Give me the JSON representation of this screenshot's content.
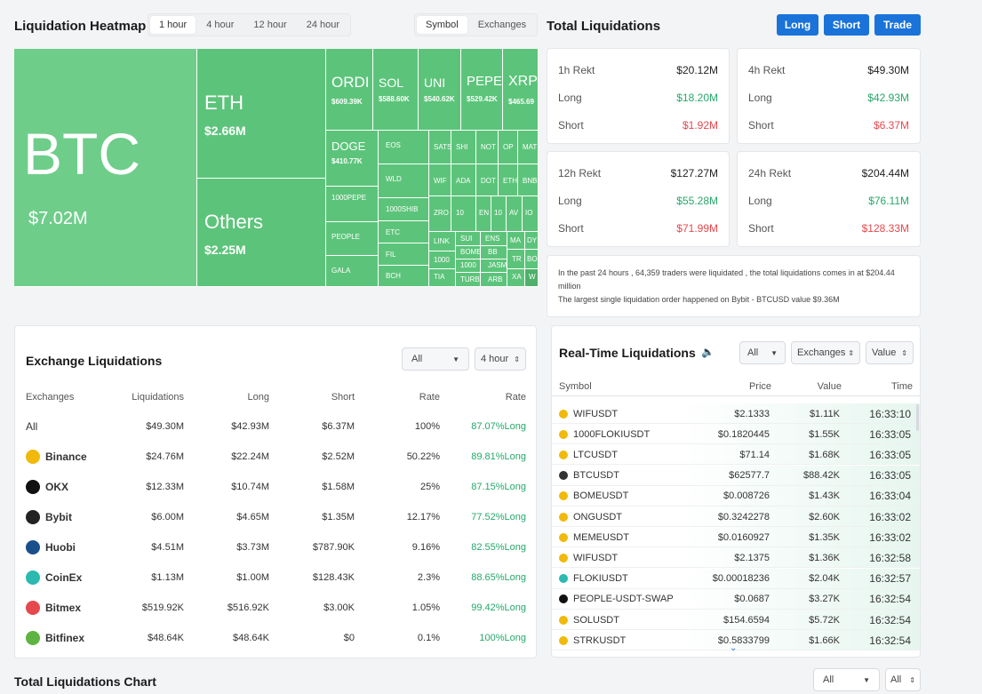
{
  "heatmap": {
    "title": "Liquidation Heatmap",
    "time_tabs": [
      "1 hour",
      "4 hour",
      "12 hour",
      "24 hour"
    ],
    "view_tabs": [
      "Symbol",
      "Exchanges"
    ],
    "tiles": [
      {
        "name": "BTC",
        "value": "$7.02M"
      },
      {
        "name": "ETH",
        "value": "$2.66M"
      },
      {
        "name": "Others",
        "value": "$2.25M"
      },
      {
        "name": "ORDI",
        "value": "$609.39K"
      },
      {
        "name": "SOL",
        "value": "$588.60K"
      },
      {
        "name": "UNI",
        "value": "$540.62K"
      },
      {
        "name": "PEPE",
        "value": "$529.42K"
      },
      {
        "name": "XRP",
        "value": "$465.69"
      },
      {
        "name": "DOGE",
        "value": "$410.77K"
      },
      {
        "name": "1000PEPE",
        "value": ""
      },
      {
        "name": "PEOPLE",
        "value": ""
      },
      {
        "name": "GALA",
        "value": ""
      },
      {
        "name": "EOS",
        "value": ""
      },
      {
        "name": "WLD",
        "value": ""
      },
      {
        "name": "1000SHIB",
        "value": ""
      },
      {
        "name": "ETC",
        "value": ""
      },
      {
        "name": "FIL",
        "value": ""
      },
      {
        "name": "BCH",
        "value": ""
      },
      {
        "name": "SATS",
        "value": ""
      },
      {
        "name": "SHI",
        "value": ""
      },
      {
        "name": "NOT",
        "value": ""
      },
      {
        "name": "OP",
        "value": ""
      },
      {
        "name": "MAT",
        "value": ""
      },
      {
        "name": "WIF",
        "value": ""
      },
      {
        "name": "ADA",
        "value": ""
      },
      {
        "name": "DOT",
        "value": ""
      },
      {
        "name": "ETH",
        "value": ""
      },
      {
        "name": "BNB",
        "value": ""
      },
      {
        "name": "ZRO",
        "value": ""
      },
      {
        "name": "10",
        "value": ""
      },
      {
        "name": "EN",
        "value": ""
      },
      {
        "name": "10",
        "value": ""
      },
      {
        "name": "AV",
        "value": ""
      },
      {
        "name": "IO",
        "value": ""
      },
      {
        "name": "LINK",
        "value": ""
      },
      {
        "name": "SUI",
        "value": ""
      },
      {
        "name": "ENS",
        "value": ""
      },
      {
        "name": "MA",
        "value": ""
      },
      {
        "name": "DY",
        "value": ""
      },
      {
        "name": "1000",
        "value": ""
      },
      {
        "name": "BOME",
        "value": ""
      },
      {
        "name": "BB",
        "value": ""
      },
      {
        "name": "TR",
        "value": ""
      },
      {
        "name": "BO",
        "value": ""
      },
      {
        "name": "TIA",
        "value": ""
      },
      {
        "name": "1000",
        "value": ""
      },
      {
        "name": "JASM",
        "value": ""
      },
      {
        "name": "XA",
        "value": ""
      },
      {
        "name": "W",
        "value": ""
      },
      {
        "name": "TURB",
        "value": ""
      },
      {
        "name": "ARB",
        "value": ""
      }
    ]
  },
  "total": {
    "title": "Total Liquidations",
    "buttons": [
      "Long",
      "Short",
      "Trade"
    ],
    "cards": [
      {
        "label": "1h Rekt",
        "total": "$20.12M",
        "long_label": "Long",
        "long": "$18.20M",
        "short_label": "Short",
        "short": "$1.92M"
      },
      {
        "label": "4h Rekt",
        "total": "$49.30M",
        "long_label": "Long",
        "long": "$42.93M",
        "short_label": "Short",
        "short": "$6.37M"
      },
      {
        "label": "12h Rekt",
        "total": "$127.27M",
        "long_label": "Long",
        "long": "$55.28M",
        "short_label": "Short",
        "short": "$71.99M"
      },
      {
        "label": "24h Rekt",
        "total": "$204.44M",
        "long_label": "Long",
        "long": "$76.11M",
        "short_label": "Short",
        "short": "$128.33M"
      }
    ],
    "summary_line1": "In the past 24 hours , 64,359 traders were liquidated , the total liquidations comes in at $204.44 million",
    "summary_line2": "The largest single liquidation order happened on Bybit - BTCUSD value $9.36M"
  },
  "exchange": {
    "title": "Exchange Liquidations",
    "filter1": "All",
    "filter2": "4 hour",
    "headers": [
      "Exchanges",
      "Liquidations",
      "Long",
      "Short",
      "Rate",
      "Rate"
    ],
    "rows": [
      {
        "name": "All",
        "liq": "$49.30M",
        "long": "$42.93M",
        "short": "$6.37M",
        "rate": "100%",
        "rate2": "87.07%Long",
        "icon": "none",
        "color": ""
      },
      {
        "name": "Binance",
        "liq": "$24.76M",
        "long": "$22.24M",
        "short": "$2.52M",
        "rate": "50.22%",
        "rate2": "89.81%Long",
        "icon": "binance-icon",
        "color": "#f0b90b"
      },
      {
        "name": "OKX",
        "liq": "$12.33M",
        "long": "$10.74M",
        "short": "$1.58M",
        "rate": "25%",
        "rate2": "87.15%Long",
        "icon": "okx-icon",
        "color": "#111111"
      },
      {
        "name": "Bybit",
        "liq": "$6.00M",
        "long": "$4.65M",
        "short": "$1.35M",
        "rate": "12.17%",
        "rate2": "77.52%Long",
        "icon": "bybit-icon",
        "color": "#222222"
      },
      {
        "name": "Huobi",
        "liq": "$4.51M",
        "long": "$3.73M",
        "short": "$787.90K",
        "rate": "9.16%",
        "rate2": "82.55%Long",
        "icon": "huobi-icon",
        "color": "#1b4f8c"
      },
      {
        "name": "CoinEx",
        "liq": "$1.13M",
        "long": "$1.00M",
        "short": "$128.43K",
        "rate": "2.3%",
        "rate2": "88.65%Long",
        "icon": "coinex-icon",
        "color": "#2bb9b0"
      },
      {
        "name": "Bitmex",
        "liq": "$519.92K",
        "long": "$516.92K",
        "short": "$3.00K",
        "rate": "1.05%",
        "rate2": "99.42%Long",
        "icon": "bitmex-icon",
        "color": "#e5484d"
      },
      {
        "name": "Bitfinex",
        "liq": "$48.64K",
        "long": "$48.64K",
        "short": "$0",
        "rate": "0.1%",
        "rate2": "100%Long",
        "icon": "bitfinex-icon",
        "color": "#5fb340"
      }
    ]
  },
  "realtime": {
    "title": "Real-Time Liquidations",
    "filter1": "All",
    "filter2": "Exchanges",
    "filter3": "Value",
    "headers": [
      "Symbol",
      "Price",
      "Value",
      "Time"
    ],
    "rows": [
      {
        "symbol": "WIFUSDT",
        "price": "$2.1333",
        "value": "$1.11K",
        "time": "16:33:10",
        "ex": "binance"
      },
      {
        "symbol": "1000FLOKIUSDT",
        "price": "$0.1820445",
        "value": "$1.55K",
        "time": "16:33:05",
        "ex": "binance"
      },
      {
        "symbol": "LTCUSDT",
        "price": "$71.14",
        "value": "$1.68K",
        "time": "16:33:05",
        "ex": "binance"
      },
      {
        "symbol": "BTCUSDT",
        "price": "$62577.7",
        "value": "$88.42K",
        "time": "16:33:05",
        "ex": "bybit"
      },
      {
        "symbol": "BOMEUSDT",
        "price": "$0.008726",
        "value": "$1.43K",
        "time": "16:33:04",
        "ex": "binance"
      },
      {
        "symbol": "ONGUSDT",
        "price": "$0.3242278",
        "value": "$2.60K",
        "time": "16:33:02",
        "ex": "binance"
      },
      {
        "symbol": "MEMEUSDT",
        "price": "$0.0160927",
        "value": "$1.35K",
        "time": "16:33:02",
        "ex": "binance"
      },
      {
        "symbol": "WIFUSDT",
        "price": "$2.1375",
        "value": "$1.36K",
        "time": "16:32:58",
        "ex": "binance"
      },
      {
        "symbol": "FLOKIUSDT",
        "price": "$0.00018236",
        "value": "$2.04K",
        "time": "16:32:57",
        "ex": "coinex"
      },
      {
        "symbol": "PEOPLE-USDT-SWAP",
        "price": "$0.0687",
        "value": "$3.27K",
        "time": "16:32:54",
        "ex": "okx"
      },
      {
        "symbol": "SOLUSDT",
        "price": "$154.6594",
        "value": "$5.72K",
        "time": "16:32:54",
        "ex": "binance"
      },
      {
        "symbol": "STRKUSDT",
        "price": "$0.5833799",
        "value": "$1.66K",
        "time": "16:32:54",
        "ex": "binance"
      }
    ]
  },
  "chart": {
    "title": "Total Liquidations Chart",
    "filter1": "All",
    "filter2": "All"
  }
}
